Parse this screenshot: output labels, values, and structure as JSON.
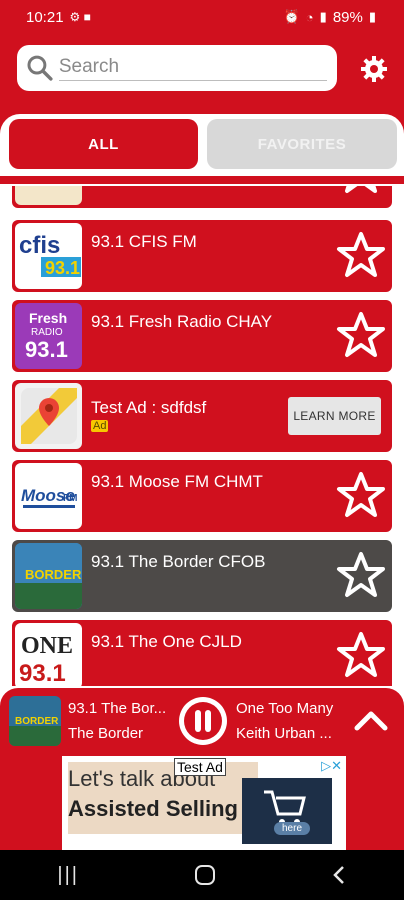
{
  "status": {
    "time": "10:21",
    "battery": "89%"
  },
  "search": {
    "placeholder": "Search"
  },
  "tabs": [
    {
      "label": "ALL"
    },
    {
      "label": "FAVORITES"
    }
  ],
  "stations": [
    {
      "name": "93.1 CFIS FM",
      "logo_text": "cfis 93.1"
    },
    {
      "name": "93.1 Fresh Radio CHAY",
      "logo_text": "Fresh RADIO 93.1"
    },
    {
      "name": "93.1 Moose FM CHMT",
      "logo_text": "Moose FM"
    },
    {
      "name": "93.1 The Border CFOB",
      "logo_text": "BORDER"
    },
    {
      "name": "93.1 The One CJLD",
      "logo_text": "ONE 93.1"
    }
  ],
  "ad_row": {
    "title": "Test Ad : sdfdsf",
    "badge": "Ad",
    "button": "LEARN MORE"
  },
  "player": {
    "station_short": "93.1 The Bor...",
    "station_sub": "The Border",
    "song": "One Too Many",
    "artist": "Keith Urban ..."
  },
  "banner": {
    "label": "Test Ad",
    "line1": "Let's talk about",
    "line2": "Assisted Selling",
    "cta": "here"
  },
  "colors": {
    "primary": "#d0101e",
    "highlight_row": "#4d4a48",
    "tab_inactive": "#d8d8d8"
  }
}
